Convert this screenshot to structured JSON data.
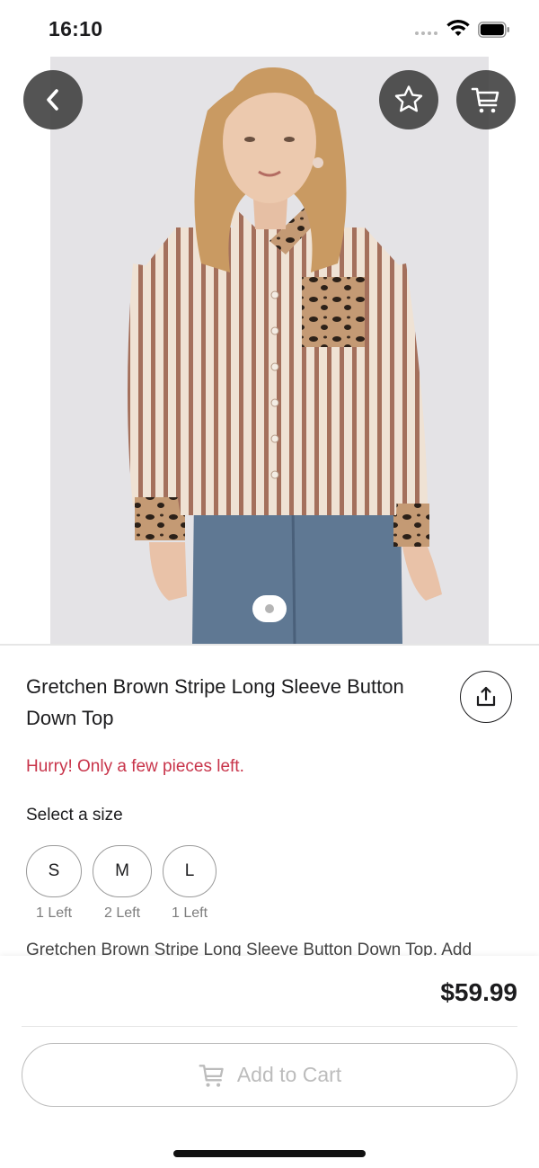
{
  "status_bar": {
    "time": "16:10"
  },
  "nav": {
    "back_icon": "chevron-left-icon",
    "favorite_icon": "star-icon",
    "cart_icon": "cart-icon"
  },
  "product": {
    "title": "Gretchen Brown Stripe Long Sleeve Button Down Top",
    "stock_warning": "Hurry! Only a few pieces left.",
    "size_label": "Select a size",
    "sizes": [
      {
        "label": "S",
        "stock": "1 Left"
      },
      {
        "label": "M",
        "stock": "2 Left"
      },
      {
        "label": "L",
        "stock": "1 Left"
      }
    ],
    "description": "Gretchen Brown Stripe Long Sleeve Button Down Top. Add"
  },
  "cart_bar": {
    "price": "$59.99",
    "add_to_cart_label": "Add to Cart"
  },
  "colors": {
    "warning": "#c8344a",
    "nav_button_bg": "#3c3c3c",
    "disabled_text": "#bcbcbc"
  }
}
